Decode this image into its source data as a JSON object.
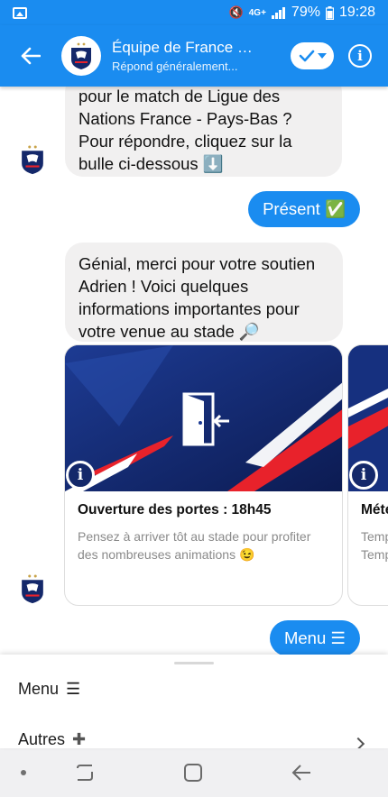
{
  "status_bar": {
    "network": "4G+",
    "battery": "79%",
    "time": "19:28"
  },
  "header": {
    "title": "Équipe de France d...",
    "subtitle": "Répond généralement..."
  },
  "messages": [
    {
      "type": "incoming",
      "lines": [
        "pour le match de Ligue des",
        "Nations France - Pays-Bas ?",
        "Pour répondre, cliquez sur la",
        "bulle ci-dessous ⬇️"
      ]
    },
    {
      "type": "outgoing",
      "text": "Présent ✅"
    },
    {
      "type": "incoming",
      "lines": [
        "Génial, merci pour votre soutien",
        "Adrien ! Voici quelques",
        "informations importantes pour",
        "votre venue au stade 🔎"
      ]
    },
    {
      "type": "outgoing",
      "text": "Menu ☰"
    }
  ],
  "cards": [
    {
      "title": "Ouverture des portes : 18h45",
      "description": "Pensez à arriver tôt au stade pour profiter des nombreuses animations 😉"
    },
    {
      "title": "Mété",
      "description_line1": "Temp",
      "description_line2": "Temp"
    }
  ],
  "sheet": {
    "items": [
      {
        "label": "Menu",
        "icon": "☰"
      },
      {
        "label": "Autres",
        "icon": "✚"
      }
    ]
  },
  "colors": {
    "brand_blue": "#1a8cf0",
    "bubble_grey": "#f1f0f0",
    "card_navy": "#14286a",
    "accent_red": "#e8222b"
  }
}
